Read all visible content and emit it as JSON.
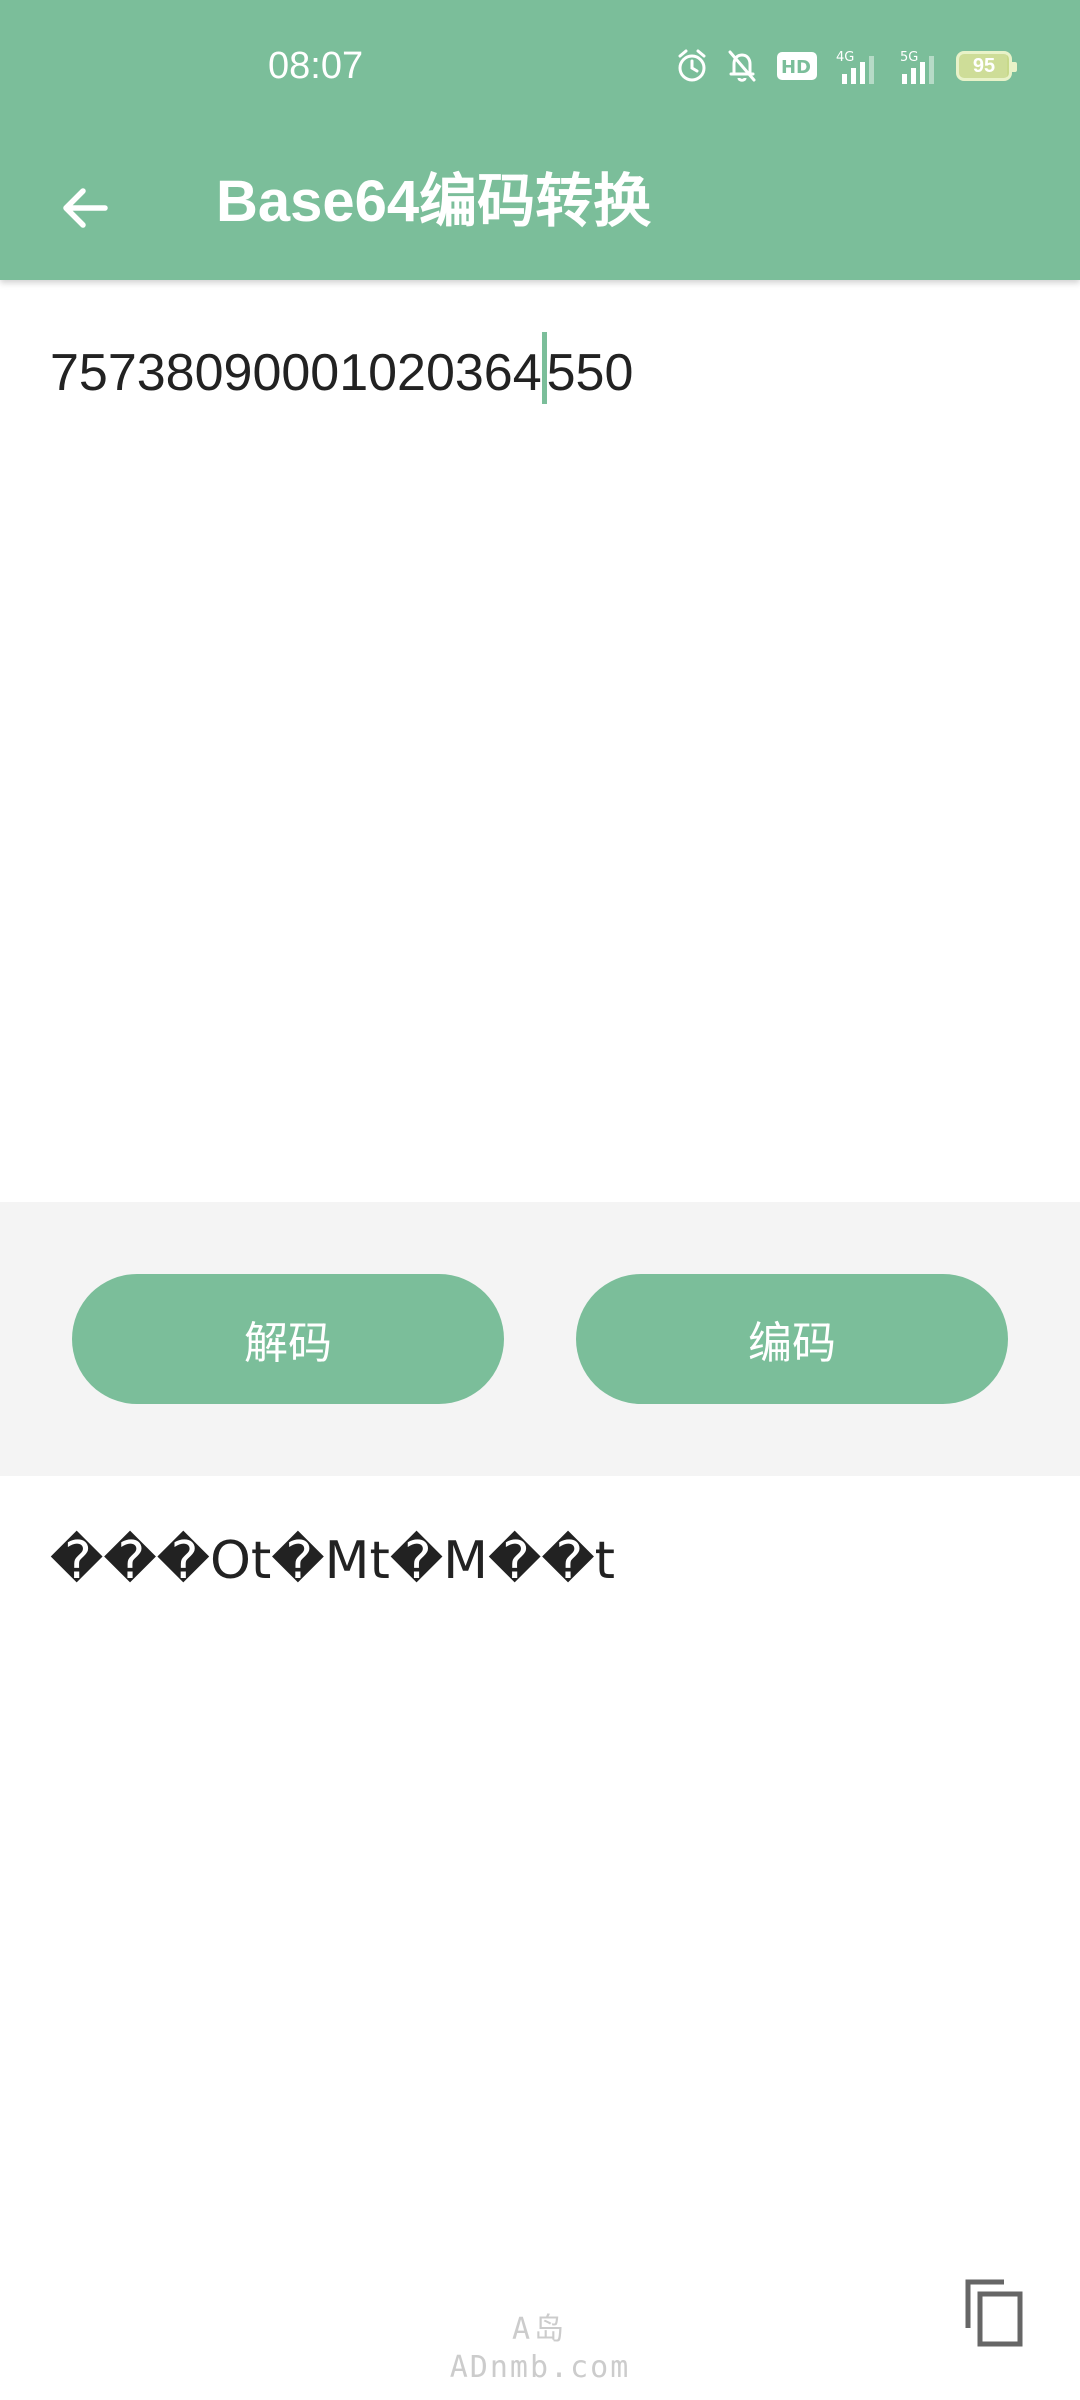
{
  "theme": {
    "primary": "#7bbe9a",
    "battery": "#c8d98a"
  },
  "status_bar": {
    "time": "08:07",
    "icons": [
      "alarm-icon",
      "bell-off-icon",
      "hd-icon",
      "signal-4g-icon",
      "signal-5g-icon"
    ],
    "hd_label": "HD",
    "net1_label": "4G",
    "net2_label": "5G",
    "battery_level": 95,
    "battery_text": "95"
  },
  "toolbar": {
    "back_icon": "arrow-left-icon",
    "title": "Base64编码转换"
  },
  "input": {
    "text_before_cursor": "75738090001020364",
    "text_after_cursor": "550"
  },
  "buttons": {
    "decode_label": "解码",
    "encode_label": "编码"
  },
  "output": {
    "text": "���Ot�Mt�M��t"
  },
  "watermark": {
    "line1": "A岛",
    "line2": "ADnmb.com"
  },
  "copy": {
    "icon": "copy-icon"
  }
}
